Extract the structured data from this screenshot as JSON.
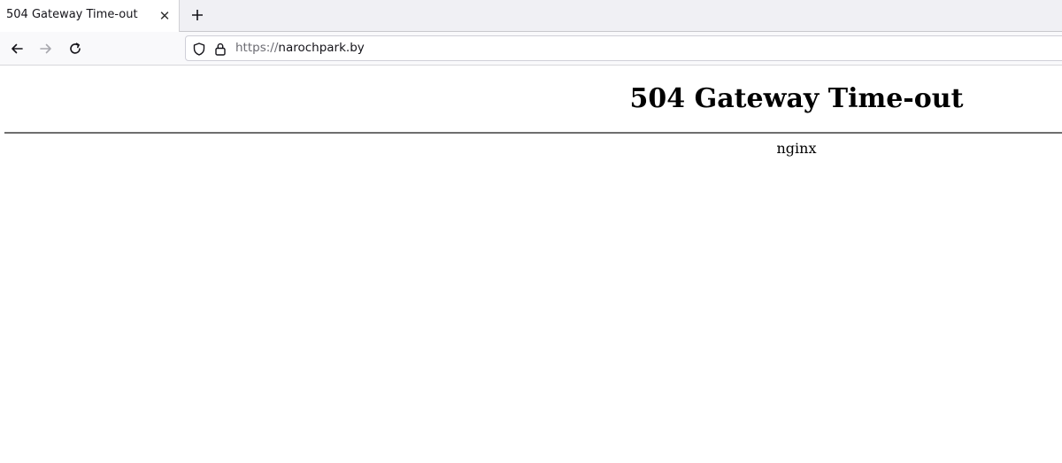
{
  "browser": {
    "tab": {
      "title": "504 Gateway Time-out",
      "close_icon": "close-icon"
    },
    "new_tab_icon": "plus-icon",
    "nav": {
      "back_icon": "arrow-left-icon",
      "forward_icon": "arrow-right-icon",
      "reload_icon": "reload-icon"
    },
    "urlbar": {
      "shield_icon": "shield-icon",
      "lock_icon": "lock-icon",
      "scheme": "https://",
      "host": "narochpark.by"
    }
  },
  "page": {
    "heading": "504 Gateway Time-out",
    "server": "nginx"
  }
}
